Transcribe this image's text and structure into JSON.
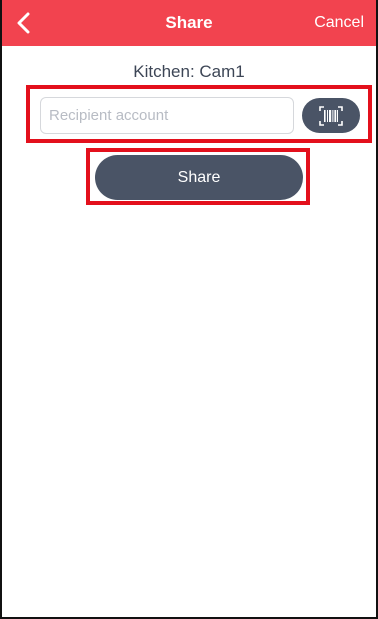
{
  "navbar": {
    "title": "Share",
    "cancel_label": "Cancel",
    "back_icon": "chevron-left-icon",
    "background_color": "#f2434f"
  },
  "device": {
    "name": "Kitchen: Cam1"
  },
  "recipient": {
    "placeholder": "Recipient account",
    "value": "",
    "scan_icon": "barcode-scan-icon"
  },
  "actions": {
    "share_label": "Share"
  },
  "colors": {
    "button": "#4a5466",
    "highlight": "#e3101c"
  }
}
